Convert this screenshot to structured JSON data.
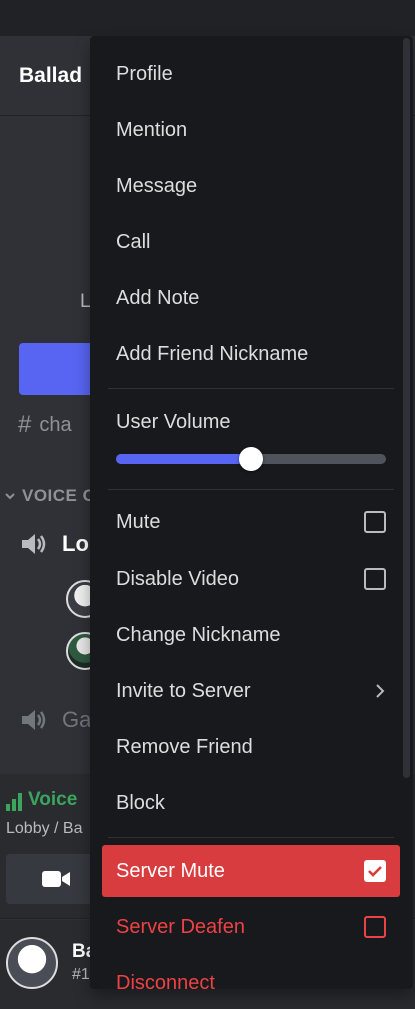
{
  "sidebar": {
    "server_name": "Ballad",
    "invite_text": "L",
    "text_channel": "cha",
    "category": "VOICE C",
    "voice_channels": [
      {
        "name": "Lo"
      },
      {
        "name": "Ga"
      }
    ]
  },
  "voice_panel": {
    "status": "Voice",
    "location": "Lobby / Ba"
  },
  "user_panel": {
    "name": "Ba",
    "tag": "#1"
  },
  "context_menu": {
    "group1": [
      "Profile",
      "Mention",
      "Message",
      "Call",
      "Add Note",
      "Add Friend Nickname"
    ],
    "user_volume": {
      "label": "User Volume",
      "value_fraction": 0.5
    },
    "mute": {
      "label": "Mute",
      "checked": false
    },
    "disable_video": {
      "label": "Disable Video",
      "checked": false
    },
    "change_nickname": "Change Nickname",
    "invite_to_server": "Invite to Server",
    "remove_friend": "Remove Friend",
    "block": "Block",
    "server_mute": {
      "label": "Server Mute",
      "checked": true
    },
    "server_deafen": {
      "label": "Server Deafen",
      "checked": false
    },
    "disconnect": "Disconnect"
  },
  "colors": {
    "menu_bg": "#18191c",
    "danger": "#ed4245",
    "danger_active": "#d83c3e",
    "accent": "#5865f2",
    "voice_green": "#3ba55d"
  },
  "icons": [
    "hash-icon",
    "speaker-icon",
    "signal-bars-icon",
    "video-camera-icon",
    "chevron-right-icon",
    "checkmark-icon",
    "chevron-down-icon"
  ]
}
